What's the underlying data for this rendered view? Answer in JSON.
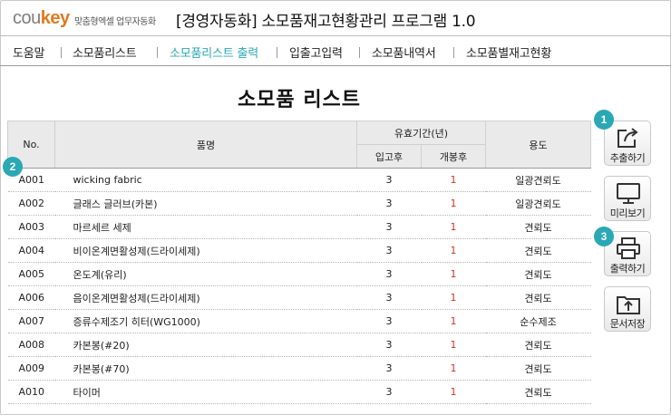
{
  "header": {
    "logo_main": "cou",
    "logo_accent": "key",
    "tagline": "맞춤형엑셀 업무자동화",
    "title": "[경영자동화] 소모품재고현황관리 프로그램 1.0"
  },
  "nav": {
    "items": [
      {
        "label": "도움말"
      },
      {
        "label": "소모품리스트"
      },
      {
        "label": "소모품리스트 출력"
      },
      {
        "label": "입출고입력"
      },
      {
        "label": "소모품내역서"
      },
      {
        "label": "소모품별재고현황"
      }
    ],
    "active_index": 2
  },
  "page": {
    "heading": "소모품 리스트"
  },
  "table": {
    "headers": {
      "no": "No.",
      "name": "품명",
      "validity": "유효기간(년)",
      "in": "입고후",
      "open": "개봉후",
      "use": "용도"
    },
    "rows": [
      {
        "code": "A001",
        "name": "wicking fabric",
        "in": "3",
        "open": "1",
        "use": "일광견뢰도"
      },
      {
        "code": "A002",
        "name": "글래스 글러브(카본)",
        "in": "3",
        "open": "1",
        "use": "일광견뢰도"
      },
      {
        "code": "A003",
        "name": "마르세르 세제",
        "in": "3",
        "open": "1",
        "use": "견뢰도"
      },
      {
        "code": "A004",
        "name": "비이온계면활성제(드라이세제)",
        "in": "3",
        "open": "1",
        "use": "견뢰도"
      },
      {
        "code": "A005",
        "name": "온도계(유리)",
        "in": "3",
        "open": "1",
        "use": "견뢰도"
      },
      {
        "code": "A006",
        "name": "음이온계면활성제(드라이세제)",
        "in": "3",
        "open": "1",
        "use": "견뢰도"
      },
      {
        "code": "A007",
        "name": "증류수제조기 히터(WG1000)",
        "in": "3",
        "open": "1",
        "use": "순수제조"
      },
      {
        "code": "A008",
        "name": "카본봉(#20)",
        "in": "3",
        "open": "1",
        "use": "견뢰도"
      },
      {
        "code": "A009",
        "name": "카본봉(#70)",
        "in": "3",
        "open": "1",
        "use": "견뢰도"
      },
      {
        "code": "A010",
        "name": "타이머",
        "in": "3",
        "open": "1",
        "use": "견뢰도"
      }
    ]
  },
  "side_buttons": [
    {
      "label": "추출하기",
      "icon": "export-icon"
    },
    {
      "label": "미리보기",
      "icon": "monitor-icon"
    },
    {
      "label": "출력하기",
      "icon": "printer-icon"
    },
    {
      "label": "문서저장",
      "icon": "upload-folder-icon"
    }
  ],
  "badges": [
    "1",
    "2",
    "3"
  ],
  "colors": {
    "accent": "#2aa8b5",
    "logo_accent": "#e07a1f",
    "value_red": "#d0312d",
    "header_bg": "#eaeaea"
  }
}
